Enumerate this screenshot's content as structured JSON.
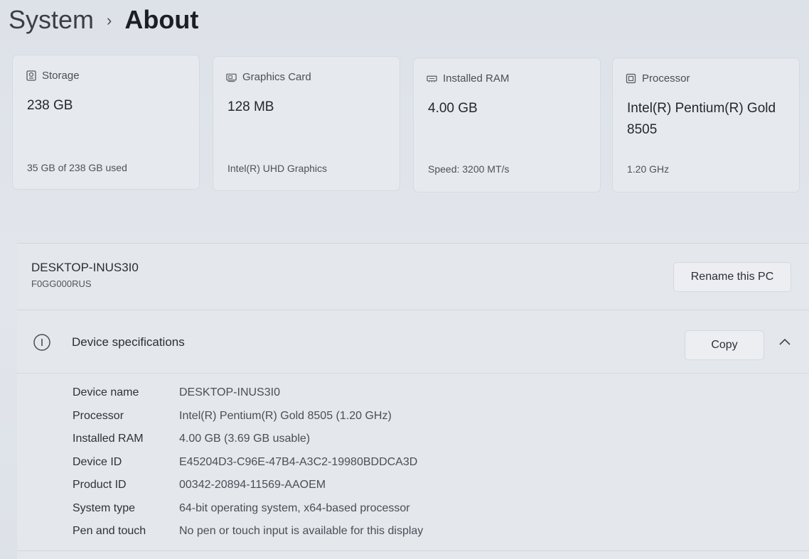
{
  "breadcrumb": {
    "parent": "System",
    "separator": "›",
    "current": "About"
  },
  "cards": [
    {
      "icon": "storage-icon",
      "title": "Storage",
      "value": "238 GB",
      "sub": "35 GB of 238 GB used"
    },
    {
      "icon": "graphics-card-icon",
      "title": "Graphics Card",
      "value": "128 MB",
      "sub": "Intel(R) UHD Graphics"
    },
    {
      "icon": "ram-icon",
      "title": "Installed RAM",
      "value": "4.00 GB",
      "sub": "Speed: 3200 MT/s"
    },
    {
      "icon": "processor-icon",
      "title": "Processor",
      "value": "Intel(R) Pentium(R) Gold 8505",
      "sub": "1.20 GHz"
    }
  ],
  "device": {
    "name": "DESKTOP-INUS3I0",
    "model": "F0GG000RUS",
    "rename_label": "Rename this PC"
  },
  "specs": {
    "title": "Device specifications",
    "copy_label": "Copy",
    "rows": [
      {
        "label": "Device name",
        "value": "DESKTOP-INUS3I0"
      },
      {
        "label": "Processor",
        "value": "Intel(R) Pentium(R) Gold 8505 (1.20 GHz)"
      },
      {
        "label": "Installed RAM",
        "value": "4.00 GB (3.69 GB usable)"
      },
      {
        "label": "Device ID",
        "value": "E45204D3-C96E-47B4-A3C2-19980BDDCA3D"
      },
      {
        "label": "Product ID",
        "value": "00342-20894-11569-AAOEM"
      },
      {
        "label": "System type",
        "value": "64-bit operating system, x64-based processor"
      },
      {
        "label": "Pen and touch",
        "value": "No pen or touch input is available for this display"
      }
    ]
  },
  "colors": {
    "background": "#dfe3e9",
    "card": "#e6e9ee",
    "text": "#1f2329"
  }
}
